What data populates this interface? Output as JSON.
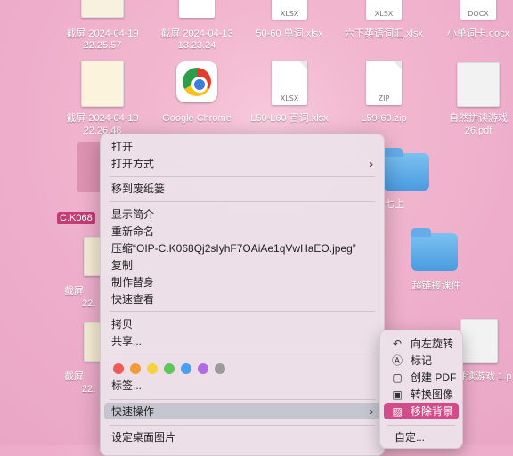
{
  "desktop": {
    "icons": [
      {
        "name": "screenshot-1",
        "label1": "截屏 2024-04-19",
        "label2": "22.25.57"
      },
      {
        "name": "screenshot-2",
        "label1": "截屏 2024-04-13",
        "label2": "13.23.24"
      },
      {
        "name": "xlsx-1",
        "label1": "50-60 单词.xlsx",
        "ext": "XLSX"
      },
      {
        "name": "xlsx-2",
        "label1": "六下英语词汇.xlsx",
        "ext": "XLSX"
      },
      {
        "name": "docx-1",
        "label1": "小单词卡.docx",
        "ext": "DOCX"
      },
      {
        "name": "screenshot-3",
        "label1": "截屏 2024-04-19",
        "label2": "22.26.48"
      },
      {
        "name": "chrome",
        "label1": "Google Chrome"
      },
      {
        "name": "xlsx-3",
        "label1": "L50-L60 百词.xlsx",
        "ext": "XLSX"
      },
      {
        "name": "zip-1",
        "label1": "L59-60.zip",
        "ext": "ZIP"
      },
      {
        "name": "pdf-1",
        "label1": "自然拼读游戏",
        "label2": "26.pdf"
      },
      {
        "name": "folder-1",
        "label1": "七上"
      },
      {
        "name": "folder-2",
        "label1": "超链接课件"
      },
      {
        "name": "partial-screenshot-4",
        "label1": "截屏",
        "label2": "22."
      },
      {
        "name": "partial-screenshot-5",
        "label1": "截屏",
        "label2": "22."
      },
      {
        "name": "partial-pdf",
        "label1": "拼读游戏 1.p"
      }
    ],
    "selected_tag": "C.K068"
  },
  "menu": {
    "items": [
      {
        "label": "打开"
      },
      {
        "label": "打开方式",
        "arrow": "›"
      },
      {
        "label": "移到废纸篓"
      },
      {
        "label": "显示简介"
      },
      {
        "label": "重新命名"
      },
      {
        "label": "压缩“OIP-C.K068Qj2sIyhF7OAiAe1qVwHaEO.jpeg”"
      },
      {
        "label": "复制"
      },
      {
        "label": "制作替身"
      },
      {
        "label": "快速查看"
      },
      {
        "label": "拷贝"
      },
      {
        "label": "共享..."
      },
      {
        "label": "标签..."
      },
      {
        "label": "快速操作",
        "arrow": "›"
      },
      {
        "label": "设定桌面图片"
      }
    ],
    "tag_colors": [
      "#f05a5a",
      "#f29b3a",
      "#f6d23b",
      "#5ec65a",
      "#4a9ef0",
      "#b26ae0",
      "#9c9c9c"
    ]
  },
  "submenu": {
    "items": [
      {
        "label": "向左旋转",
        "icon": "rotate-left-icon",
        "glyph": "↶"
      },
      {
        "label": "标记",
        "icon": "markup-icon",
        "glyph": "Ⓐ"
      },
      {
        "label": "创建 PDF",
        "icon": "pdf-icon",
        "glyph": "▢"
      },
      {
        "label": "转换图像",
        "icon": "convert-image-icon",
        "glyph": "▣"
      },
      {
        "label": "移除背景",
        "icon": "remove-background-icon",
        "glyph": "▨"
      },
      {
        "label": "自定..."
      }
    ]
  }
}
